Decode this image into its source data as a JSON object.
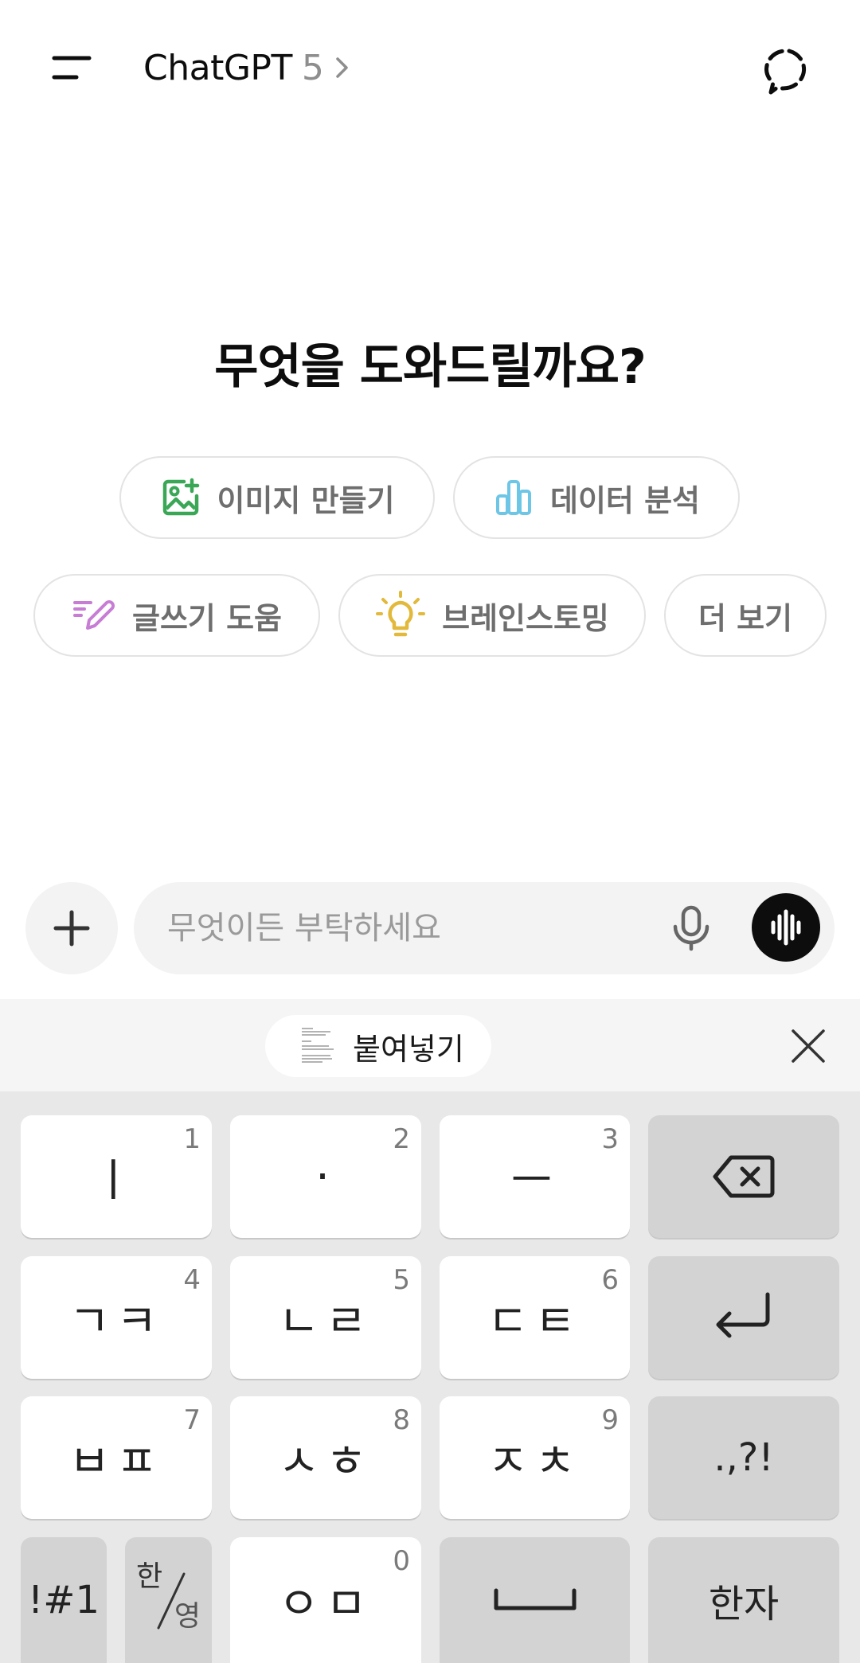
{
  "header": {
    "title": "ChatGPT",
    "version": "5"
  },
  "greeting": "무엇을 도와드릴까요?",
  "chips": {
    "image": "이미지 만들기",
    "data": "데이터 분석",
    "write": "글쓰기 도움",
    "brainstorm": "브레인스토밍",
    "more": "더 보기"
  },
  "composer": {
    "placeholder": "무엇이든 부탁하세요"
  },
  "clipboard": {
    "paste_label": "붙여넣기"
  },
  "keyboard": {
    "row1": [
      {
        "label": "ㅣ",
        "num": "1"
      },
      {
        "label": "·",
        "num": "2"
      },
      {
        "label": "ㅡ",
        "num": "3"
      }
    ],
    "row2": [
      {
        "label": "ㄱㅋ",
        "num": "4"
      },
      {
        "label": "ㄴㄹ",
        "num": "5"
      },
      {
        "label": "ㄷㅌ",
        "num": "6"
      }
    ],
    "row3": [
      {
        "label": "ㅂㅍ",
        "num": "7"
      },
      {
        "label": "ㅅㅎ",
        "num": "8"
      },
      {
        "label": "ㅈㅊ",
        "num": "9"
      }
    ],
    "punct": ".,?!",
    "symbols": "!#1",
    "lang_top": "한",
    "lang_bottom": "영",
    "row4_key": {
      "label": "ㅇㅁ",
      "num": "0"
    },
    "hanja": "한자"
  },
  "colors": {
    "image_icon": "#3aa757",
    "data_icon": "#6ec6e6",
    "write_icon": "#c77dd4",
    "brainstorm_icon": "#e2b93b"
  }
}
